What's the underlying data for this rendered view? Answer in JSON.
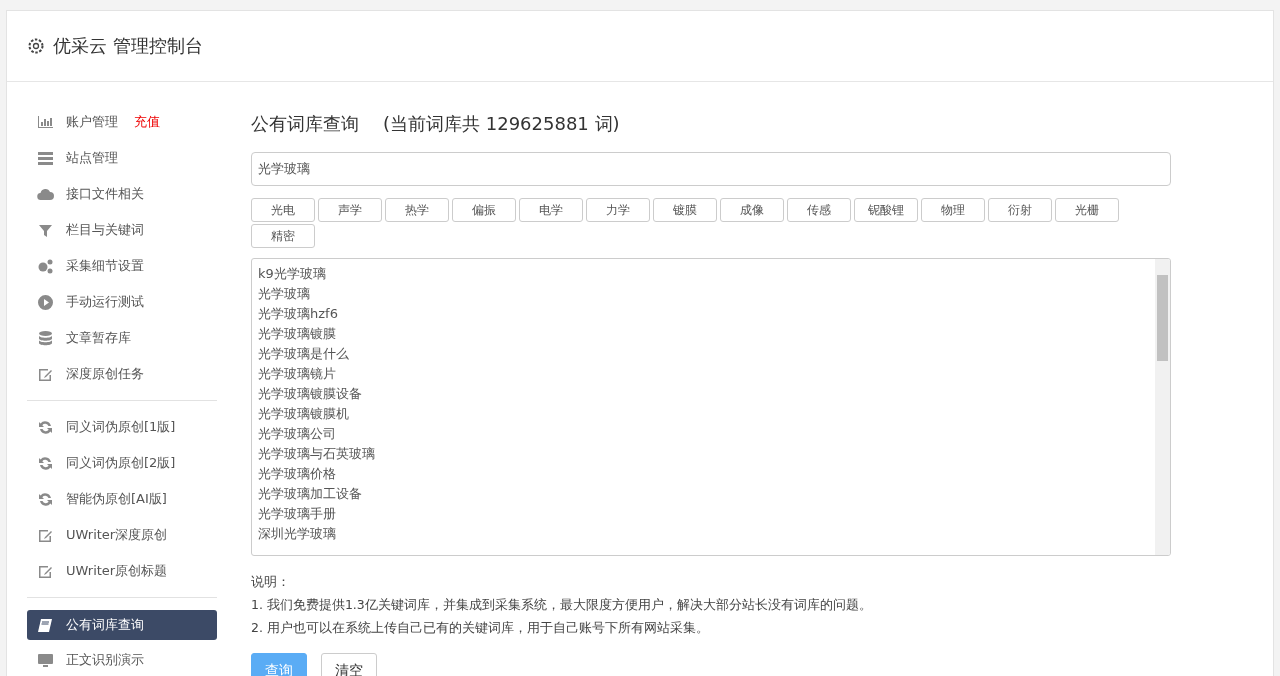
{
  "header": {
    "title": "优采云 管理控制台"
  },
  "sidebar": {
    "groups": [
      {
        "items": [
          {
            "label": "账户管理",
            "badge": "充值",
            "selected": false
          },
          {
            "label": "站点管理",
            "selected": false
          },
          {
            "label": "接口文件相关",
            "selected": false
          },
          {
            "label": "栏目与关键词",
            "selected": false
          },
          {
            "label": "采集细节设置",
            "selected": false
          },
          {
            "label": "手动运行测试",
            "selected": false
          },
          {
            "label": "文章暂存库",
            "selected": false
          },
          {
            "label": "深度原创任务",
            "selected": false
          }
        ]
      },
      {
        "items": [
          {
            "label": "同义词伪原创[1版]",
            "selected": false
          },
          {
            "label": "同义词伪原创[2版]",
            "selected": false
          },
          {
            "label": "智能伪原创[AI版]",
            "selected": false
          },
          {
            "label": "UWriter深度原创",
            "selected": false
          },
          {
            "label": "UWriter原创标题",
            "selected": false
          }
        ]
      },
      {
        "items": [
          {
            "label": "公有词库查询",
            "selected": true
          },
          {
            "label": "正文识别演示",
            "selected": false
          }
        ]
      }
    ]
  },
  "main": {
    "title": "公有词库查询",
    "subtitle": "(当前词库共 129625881 词)",
    "search": {
      "value": "光学玻璃"
    },
    "tags": [
      "光电",
      "声学",
      "热学",
      "偏振",
      "电学",
      "力学",
      "镀膜",
      "成像",
      "传感",
      "铌酸锂",
      "物理",
      "衍射",
      "光栅",
      "精密"
    ],
    "results": [
      "k9光学玻璃",
      "光学玻璃",
      "光学玻璃hzf6",
      "光学玻璃镀膜",
      "光学玻璃是什么",
      "光学玻璃镜片",
      "光学玻璃镀膜设备",
      "光学玻璃镀膜机",
      "光学玻璃公司",
      "光学玻璃与石英玻璃",
      "光学玻璃价格",
      "光学玻璃加工设备",
      "光学玻璃手册",
      "深圳光学玻璃"
    ],
    "notes_title": "说明：",
    "notes": [
      "1. 我们免费提供1.3亿关键词库，并集成到采集系统，最大限度方便用户，解决大部分站长没有词库的问题。",
      "2. 用户也可以在系统上传自己已有的关键词库，用于自己账号下所有网站采集。"
    ],
    "buttons": [
      {
        "label": "查询",
        "kind": "primary"
      },
      {
        "label": "清空",
        "kind": "default"
      }
    ]
  }
}
